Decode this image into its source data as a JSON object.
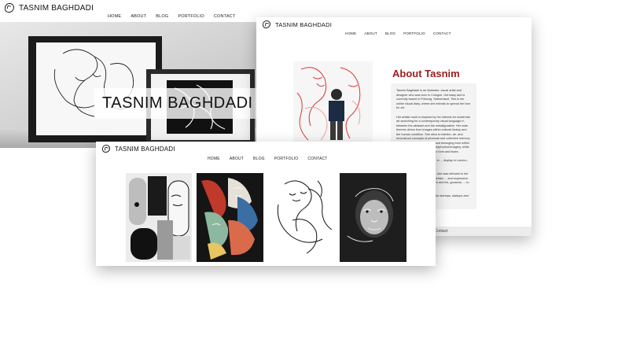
{
  "site": {
    "brand": "TASNIM BAGHDADI"
  },
  "nav": [
    "HOME",
    "ABOUT",
    "BLOG",
    "PORTFOLIO",
    "CONTACT"
  ],
  "hero": {
    "overlay_title": "TASNIM BAGHDADI"
  },
  "about": {
    "heading": "About Tasnim",
    "paragraphs": [
      "Tasnim Baghdadi is an illustrator, visual artist and designer who was born in Cologne, Germany and is currently based in Fribourg, Switzerland. This is her online visual diary, where she intends to spread her love for art.",
      "Her artistic work is inspired by her interest for modernist art searching for a contemporary visual language in between the abstract and the metafigurative. Her main themes derive from images within cultural history and the human condition. She aims to fashion, de- and reconstruct concepts of personal and collective memory as well as a sense of longing and belonging from within hybrid realities with help of metaphorical imagery, while mainly focussing on the human form and faces.",
      "... Vienna and Art History M.A. in ... display in London, Chicago,",
      "... the process of art making ... she was relevant to her body ... of pieces, allowing a certain ... and expressive technique. She ... including pen and ink, gouache, ... to explore the possibilities",
      "... works as a freelance art ... for startups, startups and ... exhibitions."
    ],
    "footer_link": "Contact"
  },
  "colors": {
    "accent": "#9b1c1c",
    "background": "#ffffff",
    "panel": "#f3f3f3"
  }
}
